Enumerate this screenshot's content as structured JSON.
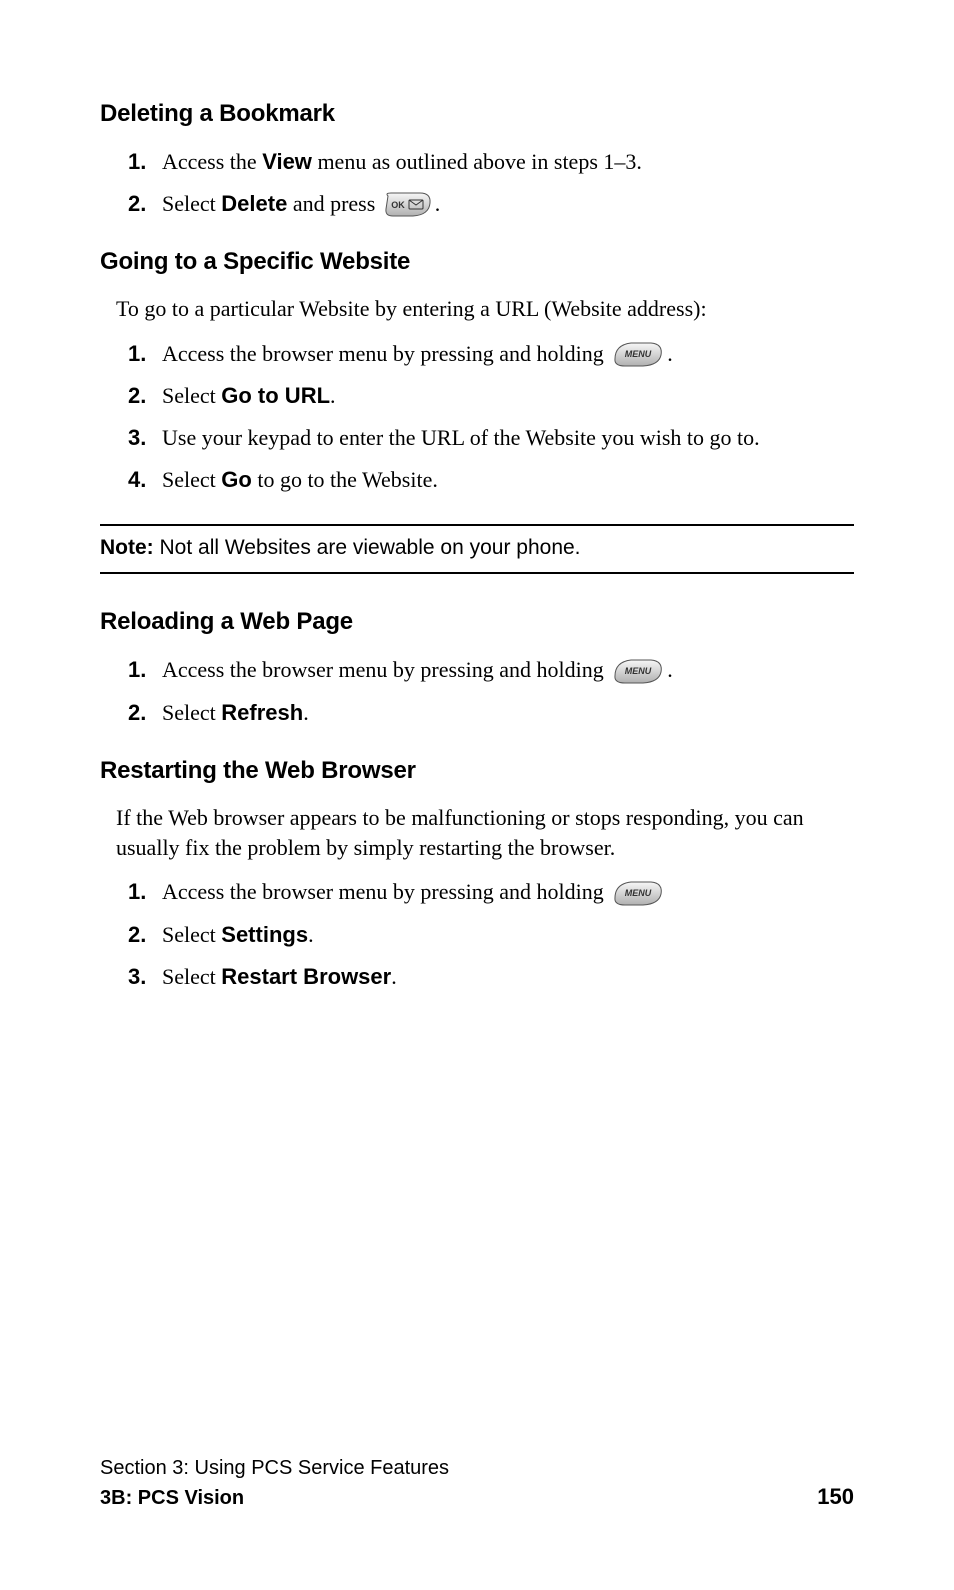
{
  "sections": {
    "deleteBookmark": {
      "heading": "Deleting a Bookmark",
      "steps": [
        {
          "num": "1.",
          "before": "Access the ",
          "bold": "View",
          "after": " menu as outlined above in steps 1–3."
        },
        {
          "num": "2.",
          "before": "Select ",
          "bold": "Delete",
          "after": " and press ",
          "button": "ok",
          "tail": "."
        }
      ]
    },
    "gotoSite": {
      "heading": "Going to a Specific Website",
      "intro": "To go to a particular Website by entering a URL (Website address):",
      "steps": [
        {
          "num": "1.",
          "before": "Access the browser menu by pressing and holding ",
          "button": "menu",
          "tail": "."
        },
        {
          "num": "2.",
          "before": "Select ",
          "bold": "Go to URL",
          "after": "."
        },
        {
          "num": "3.",
          "before": "Use your keypad to enter the URL of the Website you wish to go to."
        },
        {
          "num": "4.",
          "before": "Select ",
          "bold": "Go",
          "after": " to go to the Website."
        }
      ]
    },
    "note": {
      "label": "Note:",
      "text": " Not all Websites are viewable on your phone."
    },
    "reload": {
      "heading": "Reloading a Web Page",
      "steps": [
        {
          "num": "1.",
          "before": "Access the browser menu by pressing and holding ",
          "button": "menu",
          "tail": "."
        },
        {
          "num": "2.",
          "before": "Select ",
          "bold": "Refresh",
          "after": "."
        }
      ]
    },
    "restart": {
      "heading": "Restarting the Web Browser",
      "intro": "If the Web browser appears to be malfunctioning or stops responding, you can usually fix the problem by simply restarting the browser.",
      "steps": [
        {
          "num": "1.",
          "before": "Access the browser menu by pressing and holding ",
          "button": "menu"
        },
        {
          "num": "2.",
          "before": "Select ",
          "bold": "Settings",
          "after": "."
        },
        {
          "num": "3.",
          "before": "Select ",
          "bold": "Restart Browser",
          "after": "."
        }
      ]
    }
  },
  "footer": {
    "section": "Section 3: Using PCS Service Features",
    "subsection": "3B: PCS Vision",
    "page": "150"
  }
}
